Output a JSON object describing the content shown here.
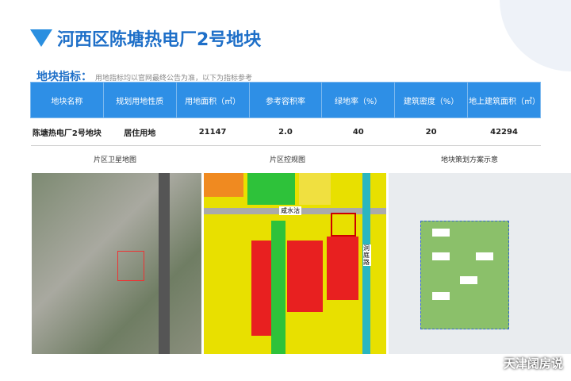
{
  "title": "河西区陈塘热电厂2号地块",
  "subtitle": {
    "label": "地块指标：",
    "note": "用地指标均以官网最终公告为准，以下为指标参考"
  },
  "table": {
    "headers": [
      "地块名称",
      "规划用地性质",
      "用地面积（㎡）",
      "参考容积率",
      "绿地率（%）",
      "建筑密度（%）",
      "地上建筑面积（㎡）"
    ],
    "row": [
      "陈塘热电厂2号地块",
      "居住用地",
      "21147",
      "2.0",
      "40",
      "20",
      "42294"
    ]
  },
  "captions": [
    "片区卫星地图",
    "片区控规图",
    "地块策划方案示意"
  ],
  "map_labels": {
    "road_h": "咸水沽",
    "road_v": "洞庭路"
  },
  "watermark": "天津阔房说"
}
